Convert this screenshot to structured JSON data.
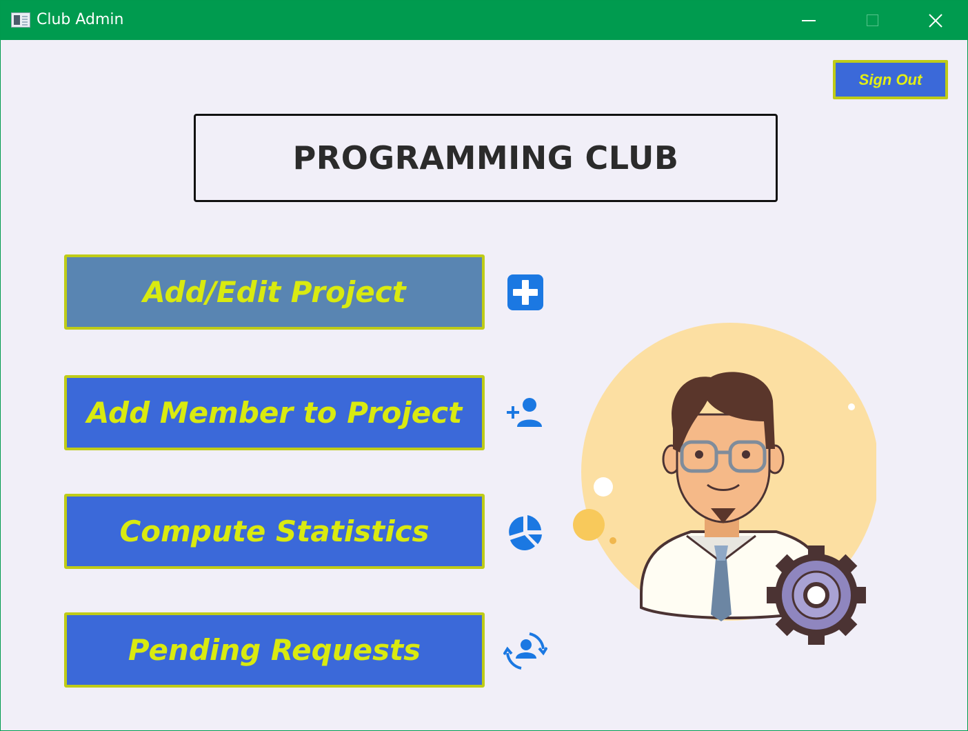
{
  "window": {
    "title": "Club Admin",
    "controls": [
      "minimize",
      "maximize",
      "close"
    ]
  },
  "header": {
    "sign_out_label": "Sign Out",
    "club_title": "PROGRAMMING CLUB"
  },
  "menu": {
    "items": [
      {
        "label": "Add/Edit Project",
        "icon": "plus-square-icon",
        "active": true
      },
      {
        "label": "Add Member to Project",
        "icon": "add-user-icon",
        "active": false
      },
      {
        "label": "Compute Statistics",
        "icon": "pie-chart-icon",
        "active": false
      },
      {
        "label": "Pending Requests",
        "icon": "user-sync-icon",
        "active": false
      }
    ]
  },
  "illustration": {
    "name": "admin-avatar-illustration"
  },
  "colors": {
    "titlebar": "#009b4f",
    "background": "#f1eff8",
    "button": "#3b69d9",
    "button_active": "#5985b2",
    "button_border": "#bfcc17",
    "button_text": "#d9ea10",
    "icon": "#1b78e2"
  }
}
